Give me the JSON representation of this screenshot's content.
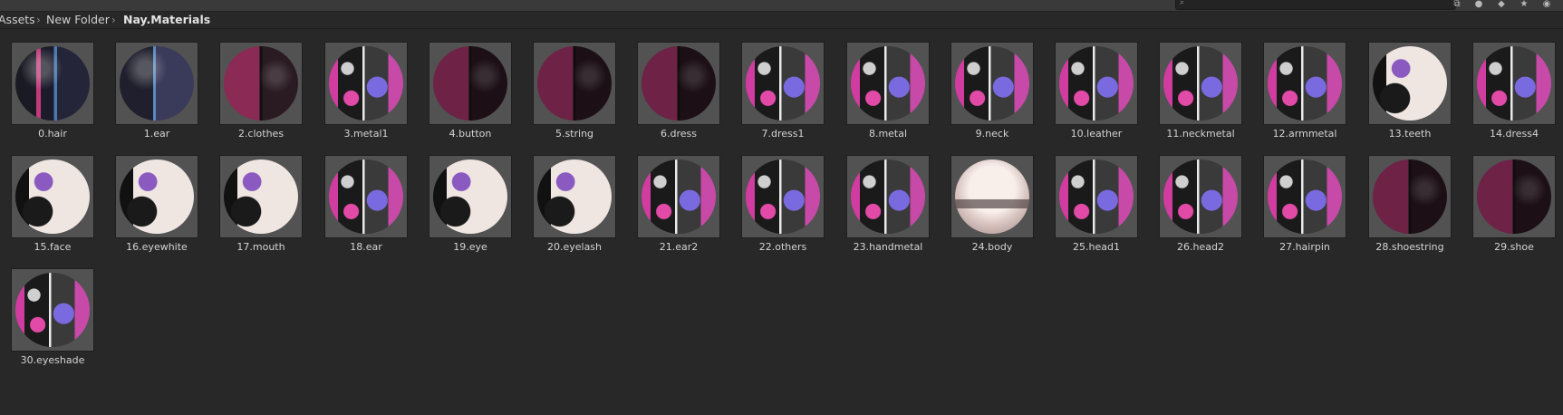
{
  "breadcrumb": {
    "items": [
      "Assets",
      "New Folder",
      "Nay.Materials"
    ]
  },
  "materials": [
    {
      "label": "0.hair",
      "style": "hair"
    },
    {
      "label": "1.ear",
      "style": "ear"
    },
    {
      "label": "2.clothes",
      "style": "cloth"
    },
    {
      "label": "3.metal1",
      "style": "multi"
    },
    {
      "label": "4.button",
      "style": "dark"
    },
    {
      "label": "5.string",
      "style": "dark"
    },
    {
      "label": "6.dress",
      "style": "dark"
    },
    {
      "label": "7.dress1",
      "style": "multi"
    },
    {
      "label": "8.metal",
      "style": "multi"
    },
    {
      "label": "9.neck",
      "style": "multi"
    },
    {
      "label": "10.leather",
      "style": "multi"
    },
    {
      "label": "11.neckmetal",
      "style": "multi"
    },
    {
      "label": "12.armmetal",
      "style": "multi"
    },
    {
      "label": "13.teeth",
      "style": "face"
    },
    {
      "label": "14.dress4",
      "style": "multi"
    },
    {
      "label": "15.face",
      "style": "face"
    },
    {
      "label": "16.eyewhite",
      "style": "face"
    },
    {
      "label": "17.mouth",
      "style": "face"
    },
    {
      "label": "18.ear",
      "style": "multi"
    },
    {
      "label": "19.eye",
      "style": "face"
    },
    {
      "label": "20.eyelash",
      "style": "face"
    },
    {
      "label": "21.ear2",
      "style": "multi"
    },
    {
      "label": "22.others",
      "style": "multi"
    },
    {
      "label": "23.handmetal",
      "style": "multi"
    },
    {
      "label": "24.body",
      "style": "body"
    },
    {
      "label": "25.head1",
      "style": "multi"
    },
    {
      "label": "26.head2",
      "style": "multi"
    },
    {
      "label": "27.hairpin",
      "style": "multi"
    },
    {
      "label": "28.shoestring",
      "style": "dark"
    },
    {
      "label": "29.shoe",
      "style": "dark"
    },
    {
      "label": "30.eyeshade",
      "style": "multi"
    }
  ]
}
